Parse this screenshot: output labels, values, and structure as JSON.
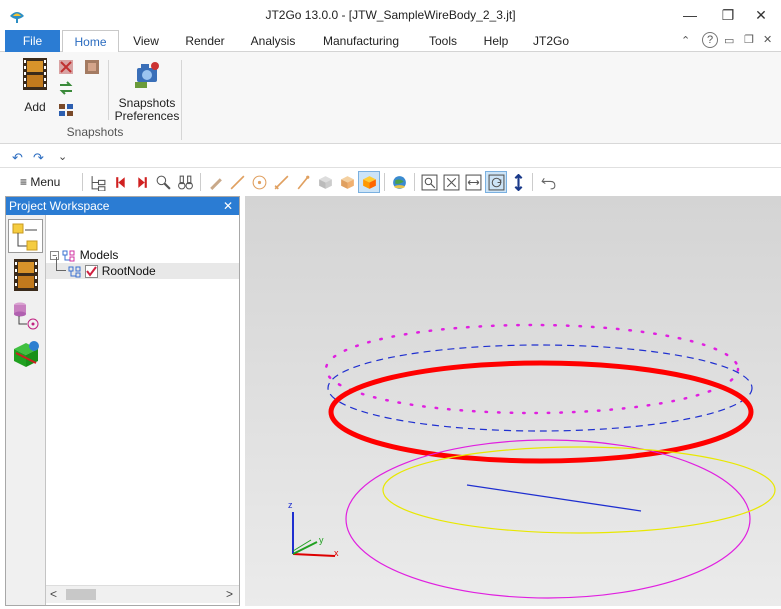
{
  "window": {
    "title": "JT2Go 13.0.0 - [JTW_SampleWireBody_2_3.jt]",
    "minimize_glyph": "—",
    "restore_glyph": "❐",
    "close_glyph": "✕"
  },
  "tabs": [
    {
      "label": "File"
    },
    {
      "label": "Home"
    },
    {
      "label": "View"
    },
    {
      "label": "Render"
    },
    {
      "label": "Analysis"
    },
    {
      "label": "Manufacturing"
    },
    {
      "label": "Tools"
    },
    {
      "label": "Help"
    },
    {
      "label": "JT2Go"
    }
  ],
  "ribbon": {
    "add_label": "Add",
    "prefs_label_1": "Snapshots",
    "prefs_label_2": "Preferences",
    "group_label": "Snapshots"
  },
  "qat": {
    "menu_label": "≡ Menu"
  },
  "workspace": {
    "title": "Project Workspace",
    "close_glyph": "✕",
    "tree": {
      "models_label": "Models",
      "root_label": "RootNode"
    },
    "scroll_left": "<",
    "scroll_right": ">"
  },
  "triad": {
    "x_label": "x",
    "y_label": "y",
    "z_label": "z"
  },
  "colors": {
    "accent": "#2b7cd3",
    "red_circle": "#ff0000",
    "magenta": "#e020e0",
    "blue": "#1f2fd0",
    "yellow": "#e8e800"
  }
}
